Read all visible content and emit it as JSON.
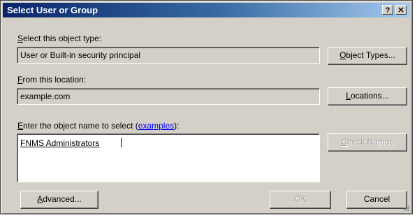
{
  "window": {
    "title": "Select User or Group",
    "help_label": "?",
    "close_label": "✕"
  },
  "object_type": {
    "label_first": "S",
    "label_rest": "elect this object type:",
    "value": "User or Built-in security principal",
    "button_first": "O",
    "button_rest": "bject Types..."
  },
  "location": {
    "label_first": "F",
    "label_rest": "rom this location:",
    "value": "example.com",
    "button_first": "L",
    "button_rest": "ocations..."
  },
  "names": {
    "label_first": "E",
    "label_rest": "nter the object name to select (",
    "link_text": "examples",
    "label_tail": "):",
    "value": "FNMS Administrators",
    "check_first": "C",
    "check_rest": "heck Names"
  },
  "footer": {
    "advanced_first": "A",
    "advanced_rest": "dvanced...",
    "ok_label": "OK",
    "cancel_label": "Cancel"
  }
}
